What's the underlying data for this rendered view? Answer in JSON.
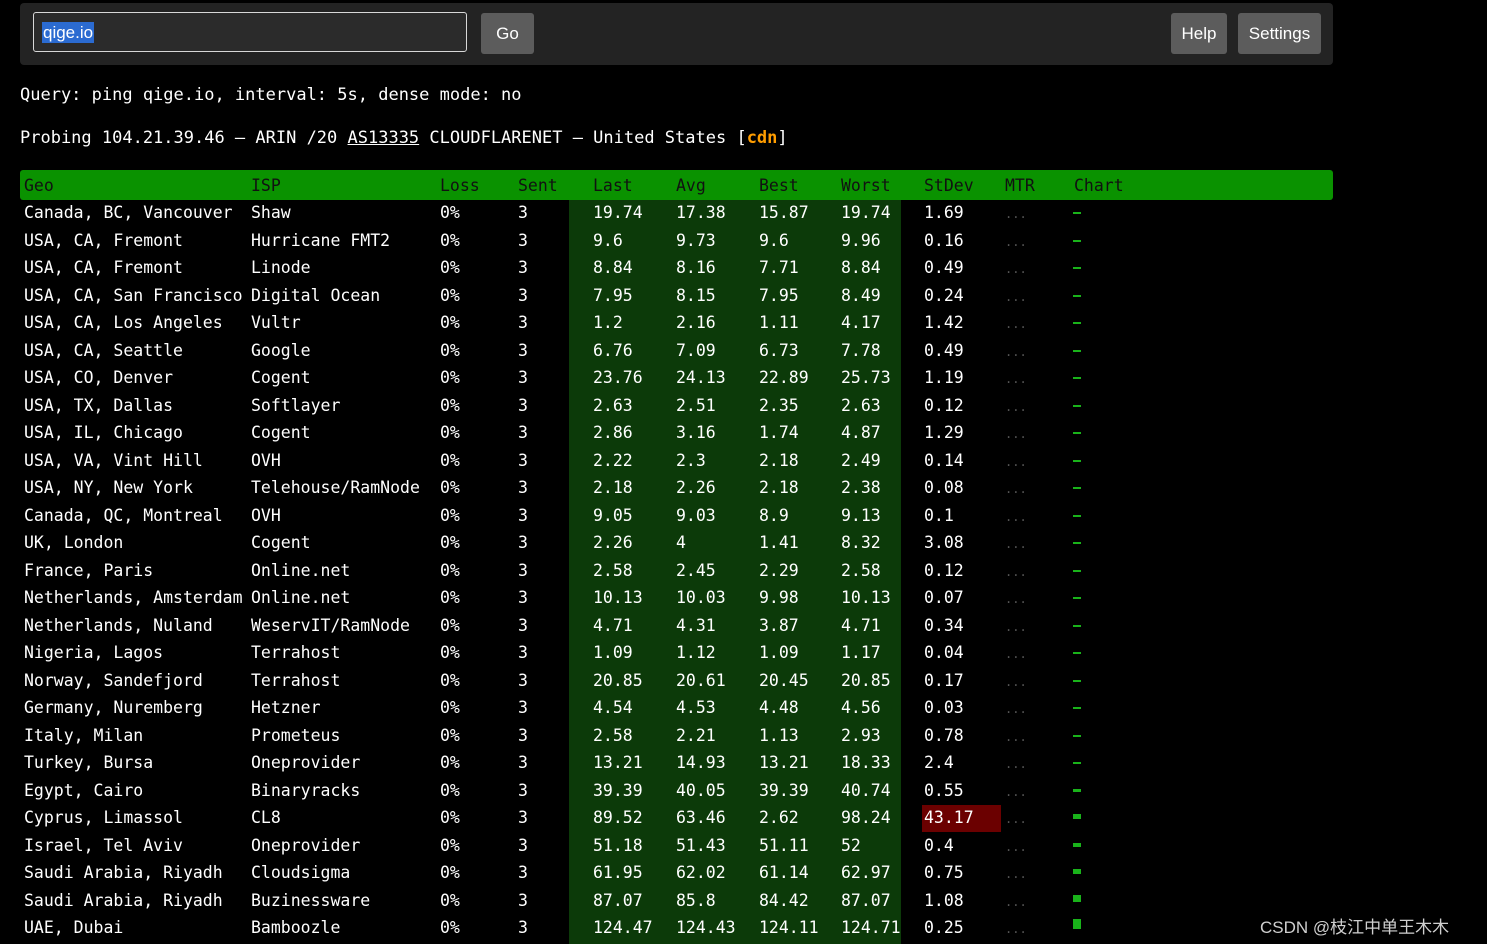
{
  "search": {
    "value": "qige.io"
  },
  "buttons": {
    "go": "Go",
    "help": "Help",
    "settings": "Settings"
  },
  "query_line": "Query: ping qige.io, interval: 5s, dense mode: no",
  "probe": {
    "prefix": "Probing 104.21.39.46 – ARIN /20 ",
    "asn": "AS13335",
    "middle": " CLOUDFLARENET – United States [",
    "tag": "cdn",
    "suffix": "]"
  },
  "table": {
    "columns": [
      "Geo",
      "ISP",
      "Loss",
      "Sent",
      "Last",
      "Avg",
      "Best",
      "Worst",
      "StDev",
      "MTR",
      "Chart"
    ],
    "mtr_placeholder": "...",
    "rows": [
      [
        "Canada, BC, Vancouver",
        "Shaw",
        "0%",
        "3",
        "19.74",
        "17.38",
        "15.87",
        "19.74",
        "1.69"
      ],
      [
        "USA, CA, Fremont",
        "Hurricane FMT2",
        "0%",
        "3",
        "9.6",
        "9.73",
        "9.6",
        "9.96",
        "0.16"
      ],
      [
        "USA, CA, Fremont",
        "Linode",
        "0%",
        "3",
        "8.84",
        "8.16",
        "7.71",
        "8.84",
        "0.49"
      ],
      [
        "USA, CA, San Francisco",
        "Digital Ocean",
        "0%",
        "3",
        "7.95",
        "8.15",
        "7.95",
        "8.49",
        "0.24"
      ],
      [
        "USA, CA, Los Angeles",
        "Vultr",
        "0%",
        "3",
        "1.2",
        "2.16",
        "1.11",
        "4.17",
        "1.42"
      ],
      [
        "USA, CA, Seattle",
        "Google",
        "0%",
        "3",
        "6.76",
        "7.09",
        "6.73",
        "7.78",
        "0.49"
      ],
      [
        "USA, CO, Denver",
        "Cogent",
        "0%",
        "3",
        "23.76",
        "24.13",
        "22.89",
        "25.73",
        "1.19"
      ],
      [
        "USA, TX, Dallas",
        "Softlayer",
        "0%",
        "3",
        "2.63",
        "2.51",
        "2.35",
        "2.63",
        "0.12"
      ],
      [
        "USA, IL, Chicago",
        "Cogent",
        "0%",
        "3",
        "2.86",
        "3.16",
        "1.74",
        "4.87",
        "1.29"
      ],
      [
        "USA, VA, Vint Hill",
        "OVH",
        "0%",
        "3",
        "2.22",
        "2.3",
        "2.18",
        "2.49",
        "0.14"
      ],
      [
        "USA, NY, New York",
        "Telehouse/RamNode",
        "0%",
        "3",
        "2.18",
        "2.26",
        "2.18",
        "2.38",
        "0.08"
      ],
      [
        "Canada, QC, Montreal",
        "OVH",
        "0%",
        "3",
        "9.05",
        "9.03",
        "8.9",
        "9.13",
        "0.1"
      ],
      [
        "UK, London",
        "Cogent",
        "0%",
        "3",
        "2.26",
        "4",
        "1.41",
        "8.32",
        "3.08"
      ],
      [
        "France, Paris",
        "Online.net",
        "0%",
        "3",
        "2.58",
        "2.45",
        "2.29",
        "2.58",
        "0.12"
      ],
      [
        "Netherlands, Amsterdam",
        "Online.net",
        "0%",
        "3",
        "10.13",
        "10.03",
        "9.98",
        "10.13",
        "0.07"
      ],
      [
        "Netherlands, Nuland",
        "WeservIT/RamNode",
        "0%",
        "3",
        "4.71",
        "4.31",
        "3.87",
        "4.71",
        "0.34"
      ],
      [
        "Nigeria, Lagos",
        "Terrahost",
        "0%",
        "3",
        "1.09",
        "1.12",
        "1.09",
        "1.17",
        "0.04"
      ],
      [
        "Norway, Sandefjord",
        "Terrahost",
        "0%",
        "3",
        "20.85",
        "20.61",
        "20.45",
        "20.85",
        "0.17"
      ],
      [
        "Germany, Nuremberg",
        "Hetzner",
        "0%",
        "3",
        "4.54",
        "4.53",
        "4.48",
        "4.56",
        "0.03"
      ],
      [
        "Italy, Milan",
        "Prometeus",
        "0%",
        "3",
        "2.58",
        "2.21",
        "1.13",
        "2.93",
        "0.78"
      ],
      [
        "Turkey, Bursa",
        "Oneprovider",
        "0%",
        "3",
        "13.21",
        "14.93",
        "13.21",
        "18.33",
        "2.4"
      ],
      [
        "Egypt, Cairo",
        "Binaryracks",
        "0%",
        "3",
        "39.39",
        "40.05",
        "39.39",
        "40.74",
        "0.55"
      ],
      [
        "Cyprus, Limassol",
        "CL8",
        "0%",
        "3",
        "89.52",
        "63.46",
        "2.62",
        "98.24",
        "43.17"
      ],
      [
        "Israel, Tel Aviv",
        "Oneprovider",
        "0%",
        "3",
        "51.18",
        "51.43",
        "51.11",
        "52",
        "0.4"
      ],
      [
        "Saudi Arabia, Riyadh",
        "Cloudsigma",
        "0%",
        "3",
        "61.95",
        "62.02",
        "61.14",
        "62.97",
        "0.75"
      ],
      [
        "Saudi Arabia, Riyadh",
        "Buzinessware",
        "0%",
        "3",
        "87.07",
        "85.8",
        "84.42",
        "87.07",
        "1.08"
      ],
      [
        "UAE, Dubai",
        "Bamboozle",
        "0%",
        "3",
        "124.47",
        "124.43",
        "124.11",
        "124.71",
        "0.25"
      ]
    ],
    "highlight_row": 22,
    "colors": {
      "header": "#0a9200",
      "latency_bg": "#0c3a09",
      "alert": "#6b0000",
      "chart": "#19b31a"
    }
  },
  "watermark": "CSDN @枝江中单王木木"
}
